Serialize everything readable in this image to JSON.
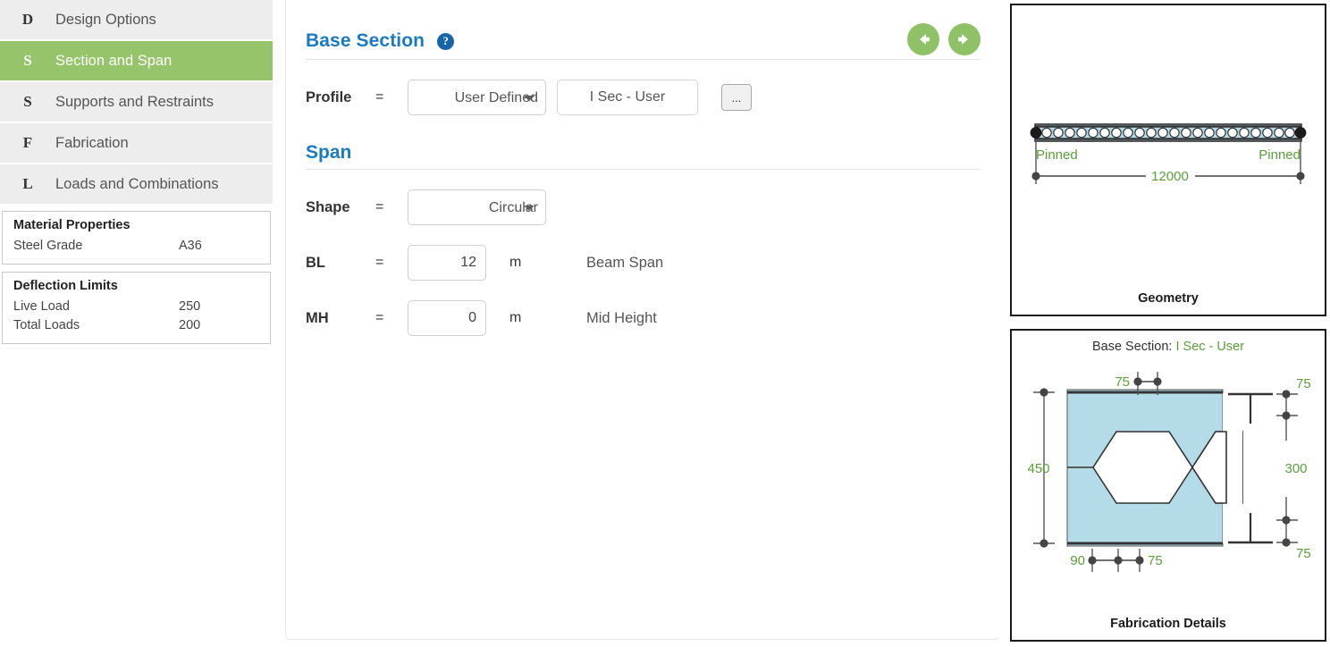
{
  "sidebar": {
    "items": [
      {
        "icon": "D",
        "label": "Design Options",
        "active": false
      },
      {
        "icon": "S",
        "label": "Section and Span",
        "active": true
      },
      {
        "icon": "S",
        "label": "Supports and Restraints",
        "active": false
      },
      {
        "icon": "F",
        "label": "Fabrication",
        "active": false
      },
      {
        "icon": "L",
        "label": "Loads and Combinations",
        "active": false
      }
    ],
    "material_properties": {
      "title": "Material Properties",
      "rows": [
        {
          "key": "Steel Grade",
          "value": "A36"
        }
      ]
    },
    "deflection_limits": {
      "title": "Deflection Limits",
      "rows": [
        {
          "key": "Live Load",
          "value": "250"
        },
        {
          "key": "Total Loads",
          "value": "200"
        }
      ]
    }
  },
  "main": {
    "base_section": {
      "title": "Base Section",
      "help_glyph": "?",
      "profile": {
        "label": "Profile",
        "eq": "=",
        "select_value": "User Defined",
        "select_options": [
          "User Defined"
        ],
        "section_button": "I Sec - User",
        "ellipsis_button": "..."
      }
    },
    "span": {
      "title": "Span",
      "shape": {
        "label": "Shape",
        "eq": "=",
        "select_value": "Circular",
        "select_options": [
          "Circular"
        ]
      },
      "bl": {
        "label": "BL",
        "eq": "=",
        "value": "12",
        "unit": "m",
        "description": "Beam Span"
      },
      "mh": {
        "label": "MH",
        "eq": "=",
        "value": "0",
        "unit": "m",
        "description": "Mid Height"
      }
    },
    "nav": {
      "back": "back-arrow",
      "forward": "forward-arrow"
    }
  },
  "right": {
    "geometry": {
      "caption": "Geometry",
      "left_support": "Pinned",
      "right_support": "Pinned",
      "span_dimension": "12000"
    },
    "fabrication": {
      "caption": "Fabrication Details",
      "header_prefix": "Base Section:",
      "header_value": "I Sec - User",
      "dim_left": "450",
      "dim_top": "75",
      "dim_bottom_left": "90",
      "dim_bottom_right": "75",
      "dim_right_top": "75",
      "dim_right_mid": "300",
      "dim_right_bottom": "75"
    }
  },
  "colors": {
    "accent_green": "#96c46a",
    "heading_blue": "#1a7ac2",
    "dim_green": "#5a9e3a",
    "section_fill": "#b3dce8"
  }
}
